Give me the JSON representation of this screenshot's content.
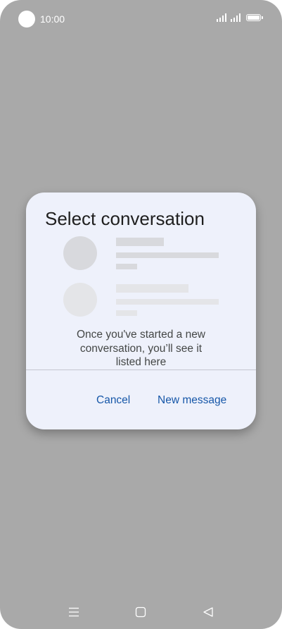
{
  "status_bar": {
    "time": "10:00",
    "icons": [
      "camera-dot",
      "signal-icon",
      "signal-icon",
      "battery-icon"
    ]
  },
  "dialog": {
    "title": "Select conversation",
    "placeholder_rows": 2,
    "empty_message_lines": [
      "Once you've started a new",
      "conversation, you’ll see it",
      "listed here"
    ],
    "buttons": {
      "cancel": "Cancel",
      "new_message": "New message"
    },
    "colors": {
      "background": "#eef1fb",
      "button_text": "#1657a8",
      "title_text": "#1f1f1f"
    }
  },
  "nav_bar": {
    "icons": [
      "menu-icon",
      "home-icon",
      "back-icon"
    ]
  },
  "colors": {
    "scrim": "#a9a9a9"
  }
}
